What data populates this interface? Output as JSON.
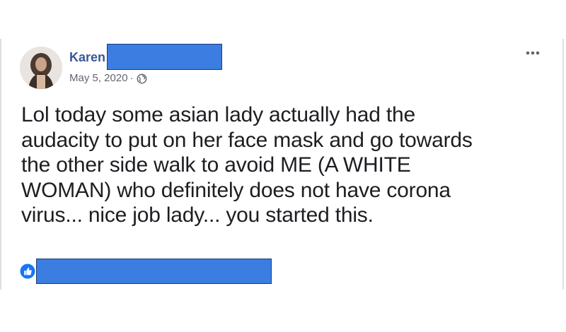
{
  "post": {
    "author_name": "Karen",
    "date": "May 5, 2020",
    "separator": "·",
    "audience_icon": "globe-icon",
    "menu_icon": "more-options-icon",
    "text_lines": [
      "Lol today some asian lady actually had the",
      "audacity to put on her face mask and go towards",
      "the other side walk to avoid ME (A WHITE",
      "WOMAN) who definitely does not have corona",
      "virus... nice job lady... you started this."
    ],
    "reaction_icon": "like-icon"
  },
  "colors": {
    "author_link": "#385898",
    "meta_text": "#616770",
    "body_text": "#1c1e21",
    "redaction_fill": "#3b7de0",
    "like_blue": "#1877f2"
  }
}
